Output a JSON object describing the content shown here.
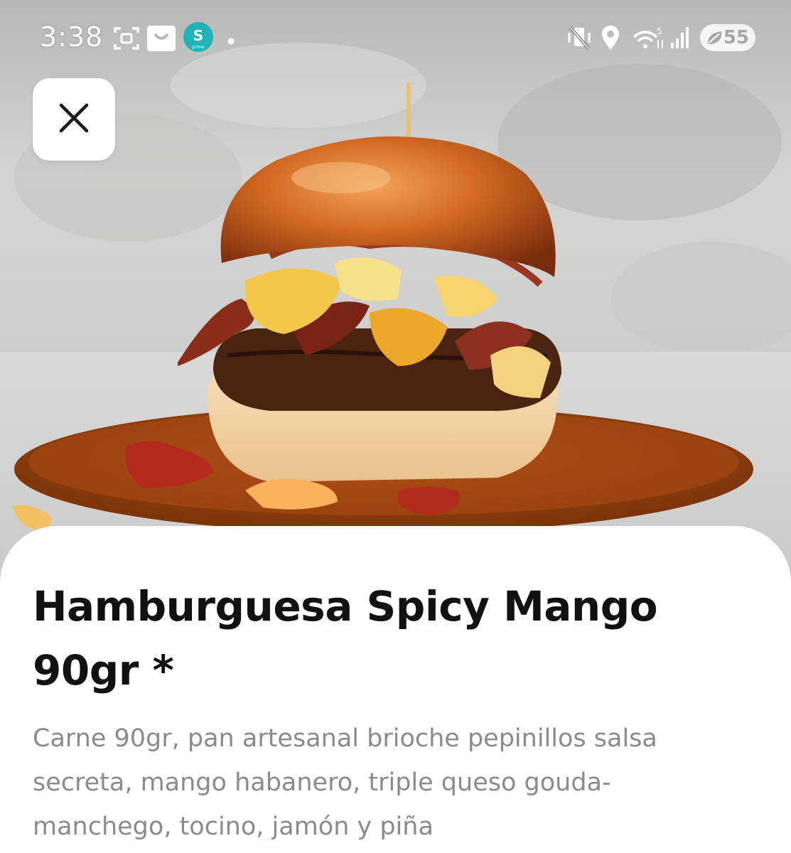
{
  "status_bar": {
    "time": "3:38",
    "battery_level": "55",
    "icons": [
      "screenshot-icon",
      "shopping-bag-icon",
      "s-app-icon",
      "notification-dot-icon",
      "vibrate-off-icon",
      "location-icon",
      "wifi-5g-icon",
      "signal-icon",
      "battery-saver-icon"
    ],
    "app_badge_letter": "S",
    "app_badge_sub": "prime"
  },
  "hero": {
    "image_subject": "burger-photo",
    "close_icon": "close-icon"
  },
  "product": {
    "title": "Hamburguesa Spicy Mango 90gr *",
    "description": "Carne 90gr, pan artesanal brioche pepinillos salsa secreta, mango habanero, triple queso gouda-manchego, tocino, jamón y piña"
  },
  "colors": {
    "title_text": "#111111",
    "description_text": "#8b8b8b",
    "sheet_background": "#ffffff",
    "app_badge": "#1fb3b8"
  }
}
